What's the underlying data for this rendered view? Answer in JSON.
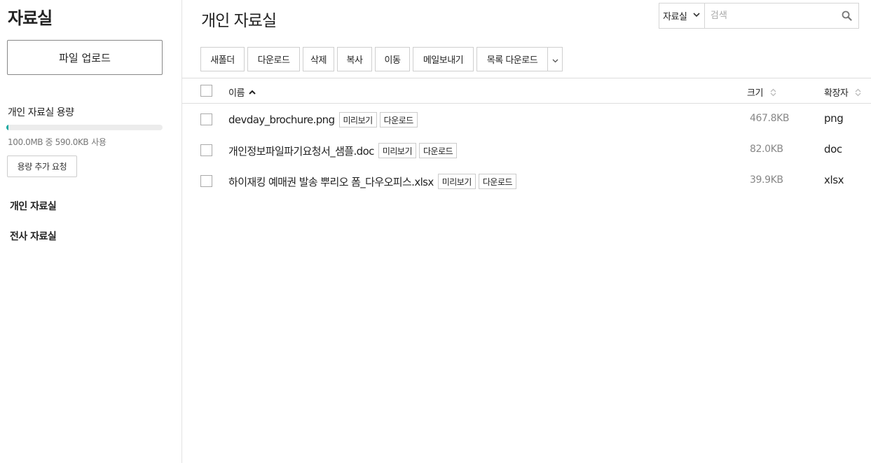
{
  "sidebar": {
    "title": "자료실",
    "upload_label": "파일 업로드",
    "capacity_label": "개인 자료실 용량",
    "capacity_used_fraction": 0.006,
    "capacity_text": "100.0MB 중 590.0KB",
    "capacity_unit": "사용",
    "request_label": "용량 추가 요청",
    "nav": {
      "personal": "개인 자료실",
      "company": "전사 자료실"
    }
  },
  "main": {
    "title": "개인 자료실",
    "search": {
      "scope": "자료실",
      "placeholder": "검색"
    },
    "toolbar": {
      "new_folder": "새폴더",
      "download": "다운로드",
      "delete": "삭제",
      "copy": "복사",
      "move": "이동",
      "mail": "메일보내기",
      "list_download": "목록 다운로드"
    },
    "columns": {
      "name": "이름",
      "size": "크기",
      "ext": "확장자"
    },
    "files": [
      {
        "name": "devday_brochure.png",
        "preview": "미리보기",
        "download": "다운로드",
        "size": "467.8KB",
        "ext": "png"
      },
      {
        "name": "개인정보파일파기요청서_샘플.doc",
        "preview": "미리보기",
        "download": "다운로드",
        "size": "82.0KB",
        "ext": "doc"
      },
      {
        "name": "하이재킹 예매권 발송 뿌리오 폼_다우오피스.xlsx",
        "preview": "미리보기",
        "download": "다운로드",
        "size": "39.9KB",
        "ext": "xlsx"
      }
    ]
  },
  "colors": {
    "accent": "#12a8a0"
  }
}
